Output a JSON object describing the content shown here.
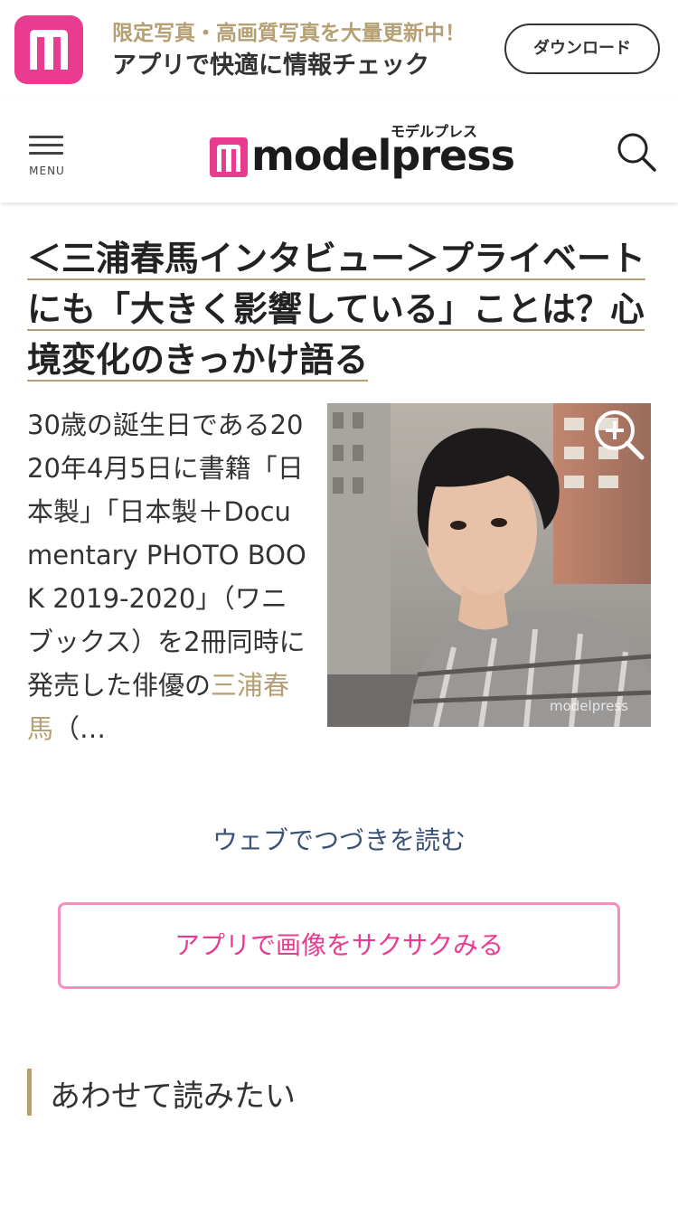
{
  "app_banner": {
    "tagline": "限定写真・高画質写真を大量更新中！",
    "subtitle": "アプリで快適に情報チェック",
    "download_label": "ダウンロード",
    "accent_color": "#e93b8f"
  },
  "header": {
    "menu_label": "MENU",
    "logo_kana": "モデルプレス",
    "logo_word": "modelpress"
  },
  "article": {
    "title": "＜三浦春馬インタビュー＞プライベートにも「大きく影響している」ことは？心境変化のきっかけ語る",
    "body_text": "30歳の誕生日である2020年4月5日に書籍「日本製」「日本製＋Documentary PHOTO BOOK 2019-2020」（ワニブックス）を2冊同時に発売した俳優の",
    "person_link": "三浦春馬",
    "body_suffix": "（…",
    "image_watermark": "modelpress"
  },
  "actions": {
    "continue_label": "ウェブでつづきを読む",
    "app_button_label": "アプリで画像をサクサクみる"
  },
  "related": {
    "heading": "あわせて読みたい"
  },
  "colors": {
    "brand_pink": "#e93b8f",
    "gold": "#b59f73",
    "link_blue": "#3b5277"
  }
}
